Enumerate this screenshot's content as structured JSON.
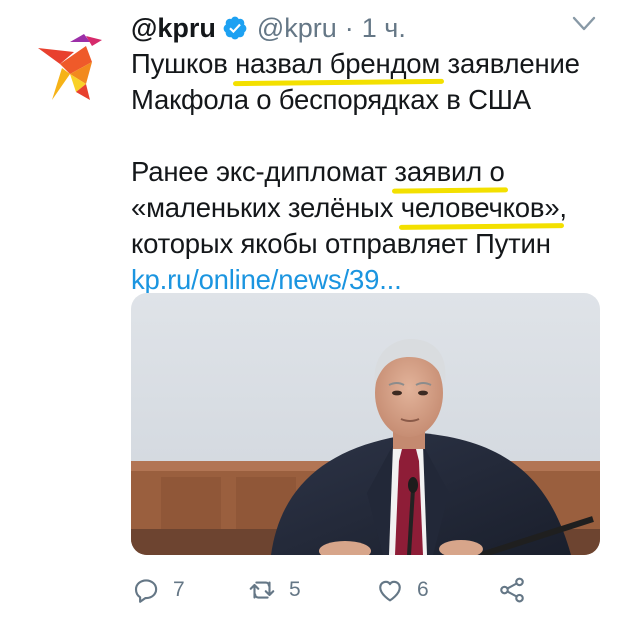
{
  "tweet": {
    "display_name": "@kpru",
    "handle": "@kpru",
    "separator": "·",
    "time": "1 ч.",
    "text": {
      "p1_part1": "Пушков ",
      "p1_hl": "назвал брендом",
      "p1_part2": " заявление",
      "p1_line2": "Макфола о беспорядках в США",
      "p2_part1": "Ранее экс-дипломат ",
      "p2_hl1": "заявил о",
      "p2_part2": "«маленьких зелёных ",
      "p2_hl2": "человечков»",
      "p2_part3": ",",
      "p2_line3": "которых якобы отправляет Путин",
      "link": "kp.ru/online/news/39..."
    }
  },
  "actions": {
    "replies": "7",
    "retweets": "5",
    "likes": "6"
  },
  "colors": {
    "link": "#1b95e0",
    "verified": "#1da1f2",
    "highlight": "#f3e000",
    "muted": "#657786"
  }
}
